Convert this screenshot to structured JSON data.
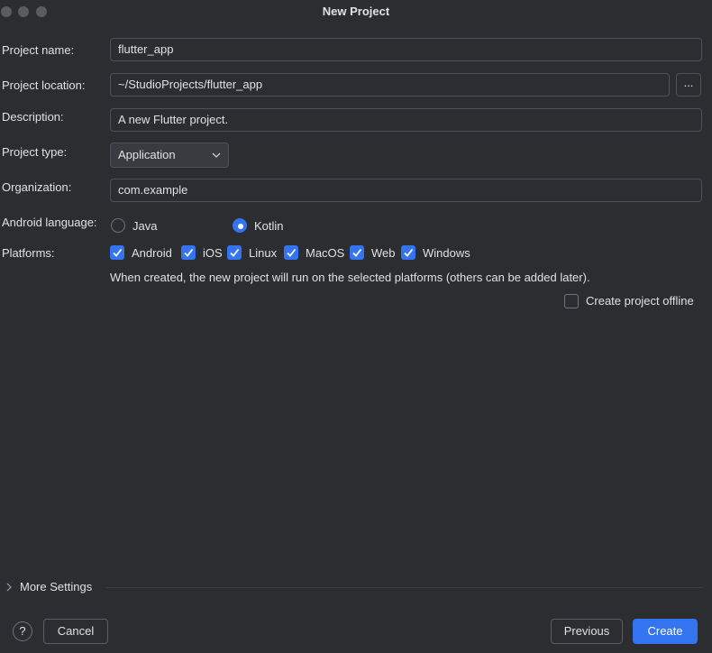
{
  "window": {
    "title": "New Project"
  },
  "form": {
    "project_name": {
      "label": "Project name:",
      "value": "flutter_app"
    },
    "project_location": {
      "label": "Project location:",
      "value": "~/StudioProjects/flutter_app",
      "browse_label": "..."
    },
    "description": {
      "label": "Description:",
      "value": "A new Flutter project."
    },
    "project_type": {
      "label": "Project type:",
      "value": "Application"
    },
    "organization": {
      "label": "Organization:",
      "value": "com.example"
    },
    "android_language": {
      "label": "Android language:",
      "options": [
        {
          "label": "Java",
          "selected": false
        },
        {
          "label": "Kotlin",
          "selected": true
        }
      ]
    },
    "platforms": {
      "label": "Platforms:",
      "options": [
        {
          "label": "Android",
          "checked": true
        },
        {
          "label": "iOS",
          "checked": true
        },
        {
          "label": "Linux",
          "checked": true
        },
        {
          "label": "MacOS",
          "checked": true
        },
        {
          "label": "Web",
          "checked": true
        },
        {
          "label": "Windows",
          "checked": true
        }
      ],
      "hint": "When created, the new project will run on the selected platforms (others can be added later)."
    },
    "offline": {
      "label": "Create project offline",
      "checked": false
    }
  },
  "more_settings": {
    "label": "More Settings"
  },
  "footer": {
    "help_label": "?",
    "cancel_label": "Cancel",
    "previous_label": "Previous",
    "create_label": "Create"
  },
  "colors": {
    "accent": "#3574f0",
    "background": "#2b2d30",
    "border": "#4e5157"
  },
  "icons": [
    "chevron-down-icon",
    "chevron-right-icon",
    "checkmark-icon",
    "help-icon"
  ]
}
